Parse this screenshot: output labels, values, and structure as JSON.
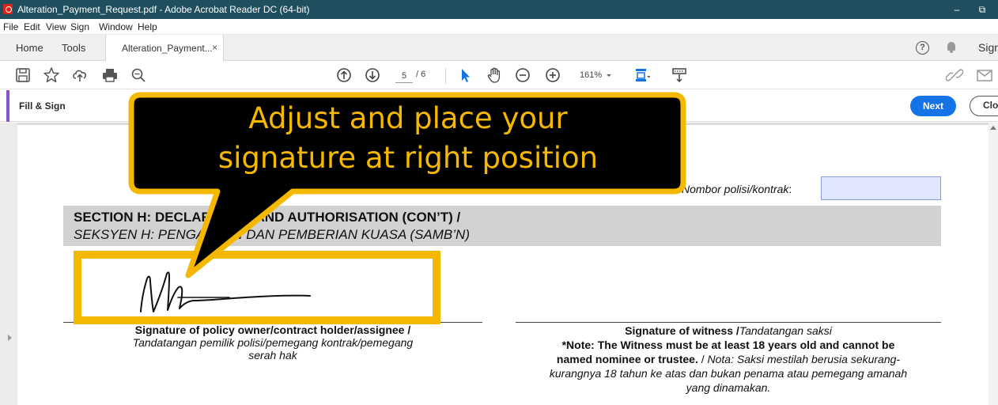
{
  "window": {
    "title": "Alteration_Payment_Request.pdf - Adobe Acrobat Reader DC (64-bit)",
    "minimize_glyph": "–",
    "restore_glyph": "⧉"
  },
  "menu": {
    "items": [
      "File",
      "Edit",
      "View",
      "Sign",
      "Window",
      "Help"
    ]
  },
  "tabs": {
    "home": "Home",
    "tools": "Tools",
    "document": "Alteration_Payment...",
    "close_glyph": "×",
    "help_glyph": "?",
    "sign_in": "Sign In"
  },
  "toolbar": {
    "icons": [
      "save-icon",
      "star-icon",
      "cloud-upload-icon",
      "print-icon",
      "zoom-search-icon",
      "page-up-icon",
      "page-down-icon",
      "select-arrow-icon",
      "hand-icon",
      "zoom-out-icon",
      "zoom-in-icon",
      "fit-page-icon",
      "read-mode-icon",
      "link-icon",
      "mail-icon"
    ],
    "current_page": "5",
    "total_pages": "/ 6",
    "zoom": "161%"
  },
  "fill_sign": {
    "title": "Fill & Sign",
    "next_label": "Next",
    "close_label": "Close",
    "accent_color": "#8a56c7",
    "button_color": "#1473e6"
  },
  "document": {
    "policy_label": "Nombor polisi/kontrak",
    "policy_colon": ":",
    "section_title": "SECTION H: DECLARATION AND AUTHORISATION (CON’T) /",
    "section_subtitle": "SEKSYEN H: PENGAKUAN DAN PEMBERIAN KUASA (SAMB’N)",
    "owner_caption_bold": "Signature of policy owner/contract holder/assignee /",
    "owner_caption_italic_1": "Tandatangan pemilik polisi/pemegang kontrak/pemegang",
    "owner_caption_italic_2": "serah hak",
    "witness_bold": "Signature of witness /",
    "witness_italic": "Tandatangan saksi",
    "note_bold_1": "*Note: The Witness must be at least 18 years old and cannot be",
    "note_bold_2": "named nominee or trustee.",
    "note_sep": " / ",
    "note_italic_a": "Nota",
    "note_italic_b": ": Saksi mestilah berusia sekurang-",
    "note_italic_3": "kurangnya 18 tahun ke atas dan bukan penama atau pemegang amanah",
    "note_italic_4": "yang dinamakan."
  },
  "callout": {
    "line1": "Adjust and place your",
    "line2": "signature at right position",
    "text_color": "#f5b800",
    "box_color": "#000000",
    "border_color": "#f5b800"
  }
}
